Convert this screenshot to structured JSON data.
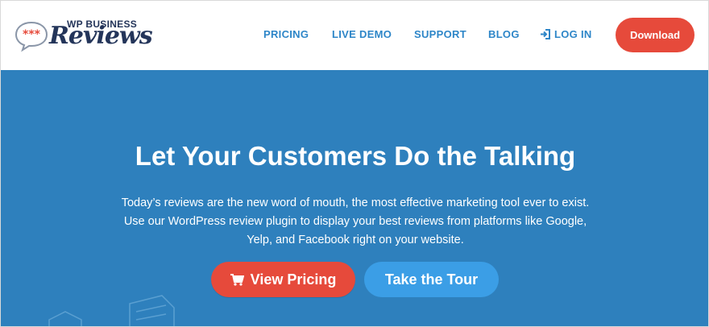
{
  "brand": {
    "logo_top": "WP BUSINESS",
    "logo_script": "Reviews",
    "bubble_stars": "***"
  },
  "nav": {
    "items": [
      {
        "label": "PRICING"
      },
      {
        "label": "LIVE DEMO"
      },
      {
        "label": "SUPPORT"
      },
      {
        "label": "BLOG"
      },
      {
        "label": "LOG IN",
        "icon": "login-icon"
      }
    ],
    "download_label": "Download"
  },
  "hero": {
    "title": "Let Your Customers Do the Talking",
    "text": "Today’s reviews are the new word of mouth, the most effective marketing tool ever to exist. Use our WordPress review plugin to display your best reviews from platforms like Google, Yelp, and Facebook right on your website.",
    "primary_cta": {
      "label": "View Pricing",
      "icon": "cart-icon"
    },
    "secondary_cta": {
      "label": "Take the Tour"
    }
  },
  "colors": {
    "hero_bg": "#2e80bd",
    "accent_red": "#e64a3b",
    "nav_blue": "#2e86c8",
    "tour_blue": "#3b9ee6",
    "logo_navy": "#24355a"
  }
}
